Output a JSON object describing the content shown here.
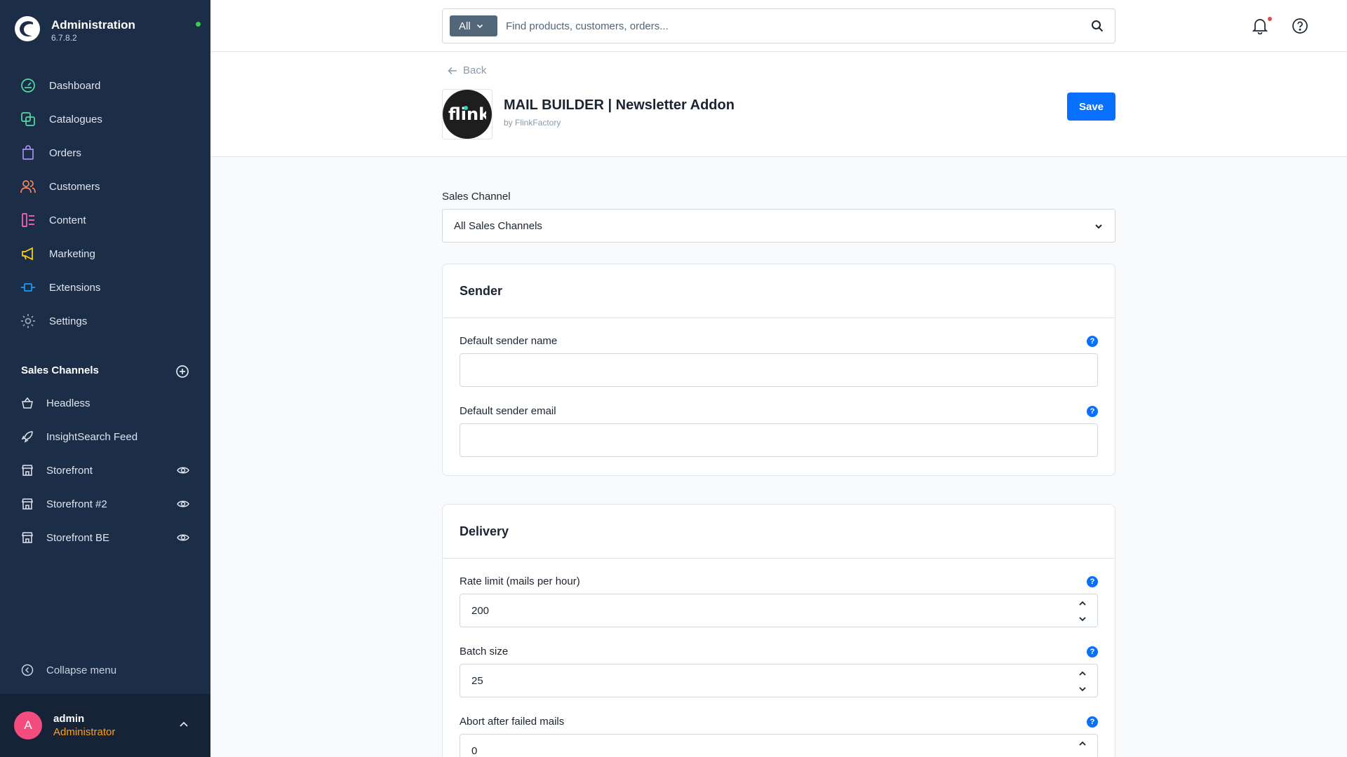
{
  "brand": {
    "title": "Administration",
    "version": "6.7.8.2"
  },
  "nav": [
    {
      "label": "Dashboard",
      "icon": "dashboard-icon",
      "color": "#57d9a3"
    },
    {
      "label": "Catalogues",
      "icon": "catalogue-icon",
      "color": "#57d9a3"
    },
    {
      "label": "Orders",
      "icon": "orders-icon",
      "color": "#a092f0"
    },
    {
      "label": "Customers",
      "icon": "customers-icon",
      "color": "#f88962"
    },
    {
      "label": "Content",
      "icon": "content-icon",
      "color": "#ff68b4"
    },
    {
      "label": "Marketing",
      "icon": "marketing-icon",
      "color": "#ffd700"
    },
    {
      "label": "Extensions",
      "icon": "extensions-icon",
      "color": "#189eff"
    },
    {
      "label": "Settings",
      "icon": "settings-icon",
      "color": "#9aa8b5"
    }
  ],
  "sales_channels": {
    "title": "Sales Channels",
    "items": [
      {
        "label": "Headless",
        "icon": "basket-icon",
        "eye": false
      },
      {
        "label": "InsightSearch Feed",
        "icon": "rocket-icon",
        "eye": false
      },
      {
        "label": "Storefront",
        "icon": "storefront-icon",
        "eye": true
      },
      {
        "label": "Storefront #2",
        "icon": "storefront-icon",
        "eye": true
      },
      {
        "label": "Storefront BE",
        "icon": "storefront-icon",
        "eye": true
      }
    ]
  },
  "collapse_label": "Collapse menu",
  "user": {
    "initial": "A",
    "name": "admin",
    "role": "Administrator"
  },
  "search": {
    "type": "All",
    "placeholder": "Find products, customers, orders..."
  },
  "header": {
    "back": "Back",
    "logo_text": "flink",
    "title": "MAIL BUILDER | Newsletter Addon",
    "by": "by FlinkFactory",
    "save": "Save"
  },
  "sales_channel": {
    "label": "Sales Channel",
    "value": "All Sales Channels"
  },
  "sender": {
    "title": "Sender",
    "name_label": "Default sender name",
    "name_value": "",
    "email_label": "Default sender email",
    "email_value": ""
  },
  "delivery": {
    "title": "Delivery",
    "rate_label": "Rate limit (mails per hour)",
    "rate_value": "200",
    "batch_label": "Batch size",
    "batch_value": "25",
    "abort_label": "Abort after failed mails",
    "abort_value": "0"
  },
  "help_glyph": "?"
}
